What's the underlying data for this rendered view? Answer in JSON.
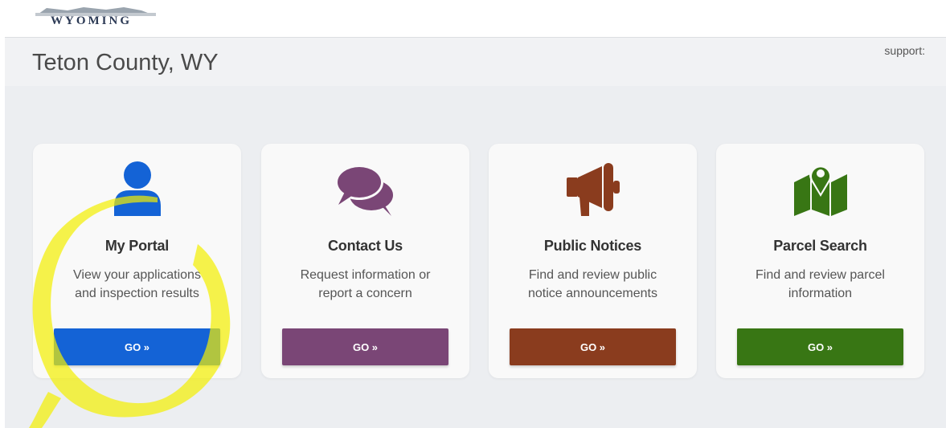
{
  "logo": {
    "text": "WYOMING"
  },
  "header": {
    "title": "Teton County, WY",
    "support_label": "support:"
  },
  "cards": [
    {
      "title": "My Portal",
      "desc_line1": "View your applications",
      "desc_line2": "and inspection results",
      "button": "GO »",
      "icon": "user-icon",
      "color": "#1463d6"
    },
    {
      "title": "Contact Us",
      "desc_line1": "Request information or",
      "desc_line2": "report a concern",
      "button": "GO »",
      "icon": "chat-bubbles-icon",
      "color": "#7a4676"
    },
    {
      "title": "Public Notices",
      "desc_line1": "Find and review public",
      "desc_line2": "notice announcements",
      "button": "GO »",
      "icon": "megaphone-icon",
      "color": "#8a3c1e"
    },
    {
      "title": "Parcel Search",
      "desc_line1": "Find and review parcel",
      "desc_line2": "information",
      "button": "GO »",
      "icon": "map-pin-icon",
      "color": "#387614"
    }
  ],
  "annotation": {
    "color": "#f4f000",
    "target": "My Portal"
  }
}
